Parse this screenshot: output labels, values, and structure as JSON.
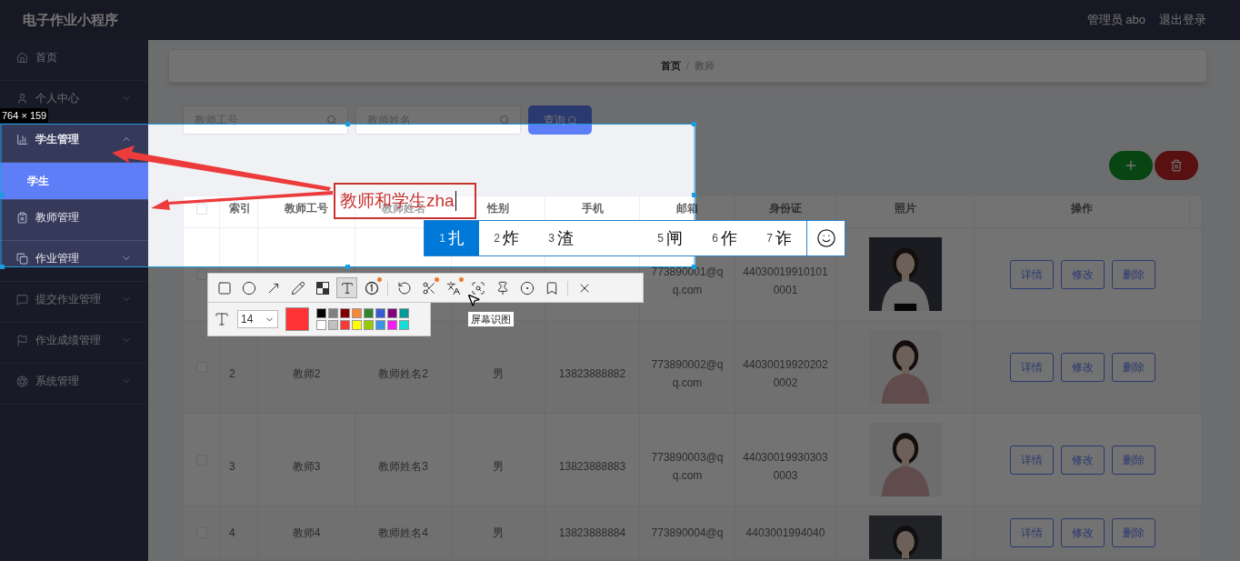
{
  "app_title": "电子作业小程序",
  "header": {
    "user": "管理员 abo",
    "logout": "退出登录"
  },
  "sidebar": {
    "items": [
      {
        "label": "首页",
        "kind": "link",
        "expanded": false,
        "selected": false
      },
      {
        "label": "个人中心",
        "kind": "submenu",
        "expanded": false,
        "selected": false
      },
      {
        "label": "学生管理",
        "kind": "submenu",
        "expanded": true,
        "selected": false,
        "children": [
          {
            "label": "学生",
            "selected": true
          }
        ]
      },
      {
        "label": "教师管理",
        "kind": "link",
        "expanded": false,
        "selected": false
      },
      {
        "label": "作业管理",
        "kind": "submenu",
        "expanded": false,
        "selected": false
      },
      {
        "label": "提交作业管理",
        "kind": "submenu",
        "expanded": false,
        "selected": false
      },
      {
        "label": "作业成绩管理",
        "kind": "submenu",
        "expanded": false,
        "selected": false
      },
      {
        "label": "系统管理",
        "kind": "submenu",
        "expanded": false,
        "selected": false
      }
    ]
  },
  "breadcrumb": [
    "首页",
    "教师"
  ],
  "breadcrumb_separator": "/",
  "search": {
    "fields": [
      {
        "placeholder": "教师工号"
      },
      {
        "placeholder": "教师姓名"
      }
    ],
    "button": "查询"
  },
  "table": {
    "header_checkbox": {
      "checked": false
    },
    "columns": [
      "索引",
      "教师工号",
      "教师姓名",
      "性别",
      "手机",
      "邮箱",
      "身份证",
      "照片",
      "操作"
    ],
    "rows": [
      {
        "checked": false,
        "cells": [
          null,
          null,
          null,
          null,
          null,
          "773890001@qq.com",
          "440300199101010001"
        ],
        "actions": [
          "详情",
          "修改",
          "删除"
        ]
      },
      {
        "checked": false,
        "cells": [
          "2",
          "教师2",
          "教师姓名2",
          "男",
          "13823888882",
          "773890002@qq.com",
          "440300199202020002"
        ],
        "actions": [
          "详情",
          "修改",
          "删除"
        ]
      },
      {
        "checked": false,
        "cells": [
          "3",
          "教师3",
          "教师姓名3",
          "男",
          "13823888883",
          "773890003@qq.com",
          "440300199303030003"
        ],
        "actions": [
          "详情",
          "修改",
          "删除"
        ]
      },
      {
        "checked": false,
        "cells": [
          "4",
          "教师4",
          "教师姓名4",
          "男",
          "13823888884",
          "773890004@q",
          "4403001994040"
        ],
        "actions": [
          "详情",
          "修改",
          "删除"
        ]
      }
    ]
  },
  "capture": {
    "size_label": "764 × 159",
    "annotation_text": "教师和学生zha",
    "ime_candidates": [
      {
        "label": "扎",
        "index": "1",
        "selected": true
      },
      {
        "label": "炸",
        "index": "2",
        "selected": false
      },
      {
        "label": "渣",
        "index": "3",
        "selected": false
      },
      {
        "label": "闸",
        "index": "5",
        "selected": false
      },
      {
        "label": "作",
        "index": "6",
        "selected": false
      },
      {
        "label": "诈",
        "index": "7",
        "selected": false
      }
    ],
    "tools": [
      {
        "kind": "rectangle",
        "selected": false,
        "badge": false
      },
      {
        "kind": "ellipse",
        "selected": false,
        "badge": false
      },
      {
        "kind": "arrow",
        "selected": false,
        "badge": false
      },
      {
        "kind": "pencil",
        "selected": false,
        "badge": false
      },
      {
        "kind": "mosaic",
        "selected": false,
        "badge": false
      },
      {
        "kind": "text",
        "selected": true,
        "badge": false
      },
      {
        "kind": "number",
        "selected": false,
        "badge": true
      },
      {
        "kind": "undo",
        "selected": false,
        "badge": false
      },
      {
        "kind": "cut",
        "selected": false,
        "badge": true
      },
      {
        "kind": "translate",
        "selected": false,
        "badge": true
      },
      {
        "kind": "recognize",
        "selected": false,
        "badge": false
      },
      {
        "kind": "pin",
        "selected": false,
        "badge": false
      },
      {
        "kind": "record",
        "selected": false,
        "badge": false
      },
      {
        "kind": "bookmark",
        "selected": false,
        "badge": false
      },
      {
        "kind": "close",
        "selected": false,
        "badge": false
      }
    ],
    "font_size": "14",
    "current_color": {
      "color": "#ff3333"
    },
    "palette": [
      {
        "color": "#000000"
      },
      {
        "color": "#808080"
      },
      {
        "color": "#800000"
      },
      {
        "color": "#f7883a"
      },
      {
        "color": "#308430"
      },
      {
        "color": "#385ad3"
      },
      {
        "color": "#800080"
      },
      {
        "color": "#009999"
      },
      {
        "color": "#ffffff"
      },
      {
        "color": "#c0c0c0"
      },
      {
        "color": "#fb3838"
      },
      {
        "color": "#ffff00"
      },
      {
        "color": "#99cc00"
      },
      {
        "color": "#3894e4"
      },
      {
        "color": "#f31bf3"
      },
      {
        "color": "#16dcdc"
      }
    ],
    "tooltip": "屏幕识图"
  }
}
